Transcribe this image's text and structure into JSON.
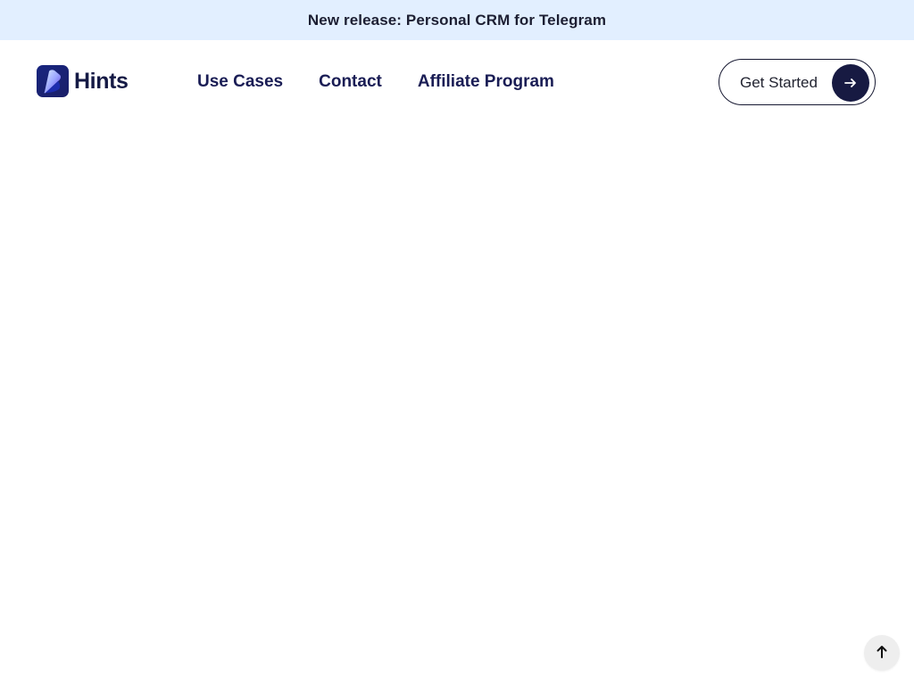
{
  "announcement": {
    "text": "New release: Personal CRM for Telegram",
    "background": "#e2efff"
  },
  "header": {
    "brand": {
      "name": "Hints",
      "logo_icon": "hints-logo-icon",
      "brand_color": "#17257f"
    },
    "nav": [
      {
        "label": "Use Cases"
      },
      {
        "label": "Contact"
      },
      {
        "label": "Affiliate Program"
      }
    ],
    "cta": {
      "label": "Get Started",
      "icon": "arrow-right-icon",
      "icon_background": "#171a42"
    }
  },
  "floating": {
    "scroll_top_icon": "arrow-up-icon",
    "background": "#eeeeee"
  }
}
